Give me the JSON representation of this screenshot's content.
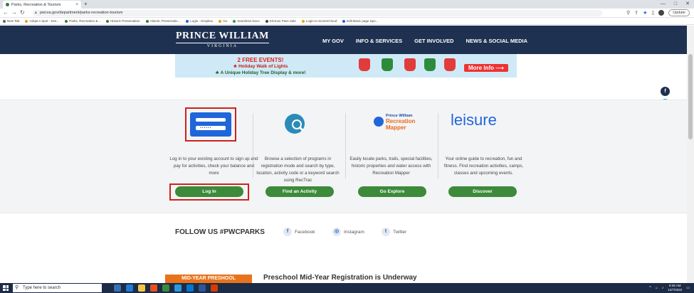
{
  "browser": {
    "tab_title": "Parks, Recreation & Tourism",
    "tab_close": "×",
    "new_tab": "+",
    "url": "pwcva.gov/department/parks-recreation-tourism",
    "update_label": "Update",
    "window_controls": [
      "—",
      "□",
      "✕"
    ],
    "bookmarks": [
      {
        "label": "New Tab",
        "color": "#5f6368"
      },
      {
        "label": "Adopt A Spot - Kee...",
        "color": "#e2a31f"
      },
      {
        "label": "Parks, Recreation &...",
        "color": "#3a7a3a"
      },
      {
        "label": "Historic Preservation",
        "color": "#3a7a3a"
      },
      {
        "label": "Historic Preservatio...",
        "color": "#3a7a3a"
      },
      {
        "label": "Login - Dropbox",
        "color": "#1f66d9"
      },
      {
        "label": "Go",
        "color": "#e2a31f"
      },
      {
        "label": "Seamless Docs",
        "color": "#2e9c4f"
      },
      {
        "label": "KiCmos Pass Sale",
        "color": "#444444"
      },
      {
        "label": "Login to ScreenCloud",
        "color": "#e2a31f"
      },
      {
        "label": "Edit Basic page Spo...",
        "color": "#1f66d9"
      }
    ]
  },
  "header": {
    "logo_line1": "PRINCE WILLIAM",
    "logo_line2": "VIRGINIA",
    "nav": [
      "MY GOV",
      "INFO & SERVICES",
      "GET INVOLVED",
      "NEWS & SOCIAL MEDIA"
    ]
  },
  "banner": {
    "line1": "2 FREE EVENTS!",
    "line2": "★ Holiday Walk of Lights",
    "line3": "★ A Unique Holiday Tree Display & more!",
    "cta": "More Info ⟶"
  },
  "services": [
    {
      "text": "Log in to your existing account to sign up and pay for activities, check your balance and more",
      "button": "Log In"
    },
    {
      "text": "Browse a selection of programs in registration mode and search by type, location, activity code or a keyword search using RecTrac",
      "button": "Find an Activity"
    },
    {
      "text": "Easily locate parks, trails, special facilities, historic properties and water access with Recreation Mapper",
      "button": "Go Explore"
    },
    {
      "text": "Your online guide to recreation, fun and fitness. Find recreation activities, camps, classes and upcoming events.",
      "button": "Discover"
    }
  ],
  "mapper_logo": {
    "line1": "Prince William",
    "line2": "Recreation",
    "line3": "Mapper"
  },
  "leisure_logo": "leisure",
  "login_card_dots": "••••••",
  "follow": {
    "title": "FOLLOW US #PWCPARKS",
    "links": [
      "Facebook",
      "Instagram",
      "Twitter"
    ]
  },
  "preview": {
    "tag": "MID-YEAR PRESHOOL",
    "title": "Preschool Mid-Year Registration is Underway"
  },
  "taskbar": {
    "search_placeholder": "Type here to search",
    "time": "9:36 AM",
    "date": "12/7/2022"
  },
  "colors": {
    "header_bg": "#1f3150",
    "button_green": "#3c8a3a",
    "highlight_red": "#d0201a",
    "leisure_blue": "#1f66d9"
  }
}
